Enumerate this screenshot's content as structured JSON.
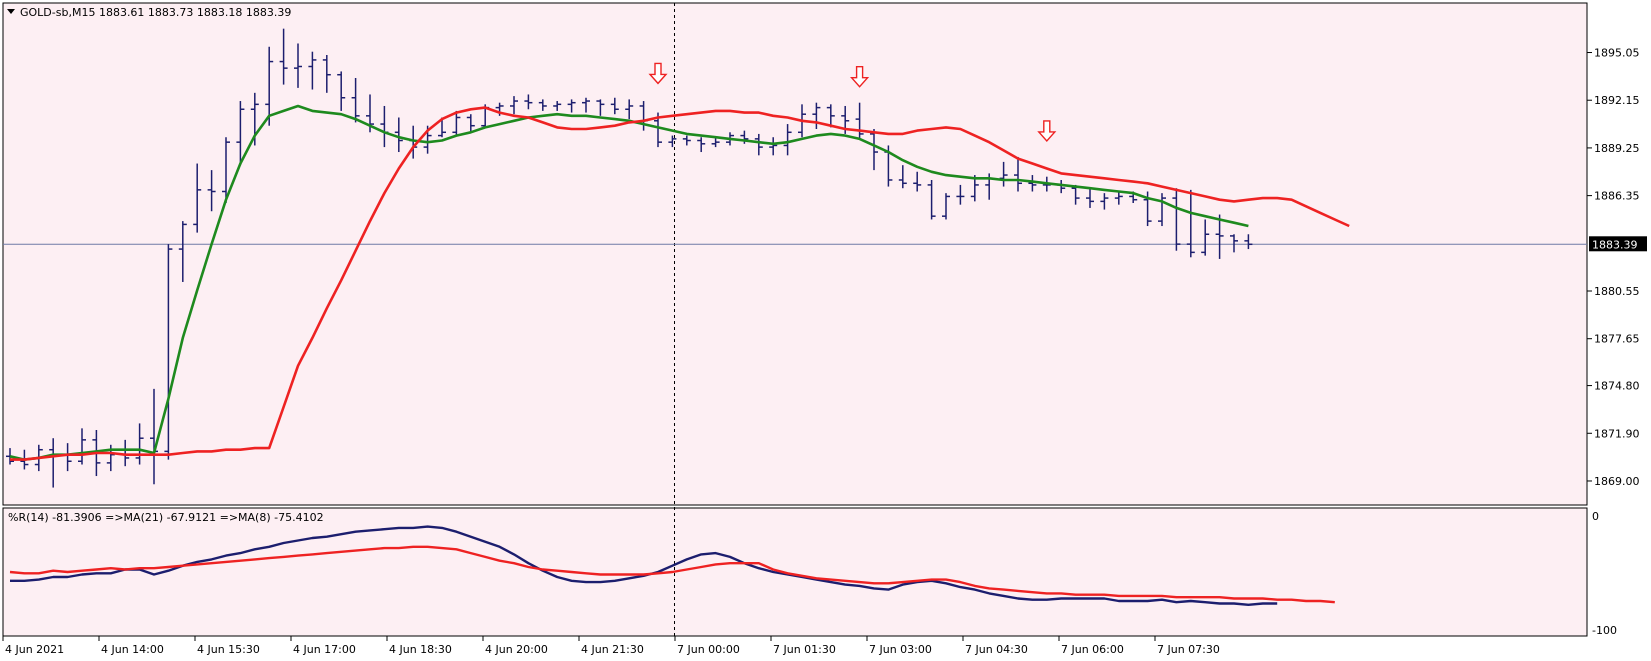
{
  "window": {
    "symbol_info": "GOLD-sb,M15  1883.61 1883.73 1883.18 1883.39",
    "background": "#fdeff3"
  },
  "indicator": {
    "label": "%R(14) -81.3906  =>MA(21) -67.9121  =>MA(8) -75.4102",
    "scale_top": "0",
    "scale_bottom": "-100"
  },
  "colors": {
    "bars": "#1c1e6e",
    "ma_fast": "#1e8a1e",
    "ma_slow": "#ee2222",
    "wpr_line": "#1c1e6e",
    "wpr_ma": "#ee2222",
    "price_line": "#6f7aa6",
    "arrow": "#ee2222"
  },
  "current_price": "1883.39",
  "chart_data": [
    {
      "type": "ohlc",
      "title": "GOLD-sb,M15",
      "price_ticks": [
        "1895.05",
        "1892.15",
        "1889.25",
        "1886.35",
        "1883.39",
        "1880.55",
        "1877.65",
        "1874.80",
        "1871.90",
        "1869.00"
      ],
      "y_range": [
        1867.6,
        1898.0
      ],
      "time_labels": [
        "4 Jun 2021",
        "4 Jun 14:00",
        "4 Jun 15:30",
        "4 Jun 17:00",
        "4 Jun 18:30",
        "4 Jun 20:00",
        "4 Jun 21:30",
        "7 Jun 00:00",
        "7 Jun 01:30",
        "7 Jun 03:00",
        "7 Jun 04:30",
        "7 Jun 06:00",
        "7 Jun 07:30"
      ],
      "bars": [
        [
          1870.5,
          1871.0,
          1870.0,
          1870.2
        ],
        [
          1870.2,
          1870.9,
          1869.7,
          1870.0
        ],
        [
          1870.0,
          1871.2,
          1869.6,
          1870.9
        ],
        [
          1870.9,
          1871.6,
          1868.6,
          1870.6
        ],
        [
          1870.6,
          1871.3,
          1869.6,
          1870.2
        ],
        [
          1870.2,
          1872.2,
          1870.0,
          1871.5
        ],
        [
          1871.5,
          1872.1,
          1869.3,
          1870.1
        ],
        [
          1870.1,
          1871.2,
          1869.6,
          1870.6
        ],
        [
          1870.6,
          1871.5,
          1869.9,
          1870.4
        ],
        [
          1870.4,
          1872.5,
          1870.0,
          1871.6
        ],
        [
          1871.6,
          1874.6,
          1868.8,
          1870.8
        ],
        [
          1870.8,
          1883.4,
          1870.3,
          1883.1
        ],
        [
          1883.1,
          1884.8,
          1881.1,
          1884.6
        ],
        [
          1884.6,
          1888.3,
          1884.1,
          1886.7
        ],
        [
          1886.7,
          1887.9,
          1885.4,
          1886.6
        ],
        [
          1886.6,
          1889.9,
          1885.9,
          1889.6
        ],
        [
          1889.6,
          1892.1,
          1888.2,
          1891.6
        ],
        [
          1891.6,
          1892.6,
          1889.4,
          1891.9
        ],
        [
          1891.9,
          1895.4,
          1890.6,
          1894.5
        ],
        [
          1894.5,
          1896.5,
          1893.1,
          1894.1
        ],
        [
          1894.1,
          1895.6,
          1892.9,
          1894.2
        ],
        [
          1894.2,
          1895.1,
          1892.8,
          1894.6
        ],
        [
          1894.6,
          1894.9,
          1892.6,
          1893.7
        ],
        [
          1893.7,
          1893.9,
          1891.5,
          1892.3
        ],
        [
          1892.3,
          1893.5,
          1890.8,
          1891.2
        ],
        [
          1891.2,
          1892.5,
          1890.2,
          1890.7
        ],
        [
          1890.7,
          1891.8,
          1889.3,
          1890.2
        ],
        [
          1890.2,
          1891.1,
          1889.0,
          1889.7
        ],
        [
          1889.7,
          1890.6,
          1888.6,
          1889.3
        ],
        [
          1889.3,
          1890.6,
          1888.9,
          1890.0
        ],
        [
          1890.0,
          1891.1,
          1889.9,
          1890.2
        ],
        [
          1890.2,
          1891.5,
          1890.0,
          1891.1
        ],
        [
          1891.1,
          1891.3,
          1890.2,
          1890.6
        ],
        [
          1890.6,
          1891.9,
          1890.5,
          1891.7
        ],
        [
          1891.7,
          1892.0,
          1891.2,
          1891.8
        ],
        [
          1891.8,
          1892.4,
          1891.3,
          1892.1
        ],
        [
          1892.1,
          1892.5,
          1891.6,
          1892.0
        ],
        [
          1892.0,
          1892.2,
          1891.5,
          1891.8
        ],
        [
          1891.8,
          1892.1,
          1891.5,
          1891.9
        ],
        [
          1891.9,
          1892.2,
          1891.4,
          1892.0
        ],
        [
          1892.0,
          1892.3,
          1891.4,
          1892.1
        ],
        [
          1892.1,
          1892.2,
          1891.2,
          1891.9
        ],
        [
          1891.9,
          1892.3,
          1891.3,
          1891.6
        ],
        [
          1891.6,
          1892.2,
          1891.0,
          1891.8
        ],
        [
          1891.8,
          1892.1,
          1890.3,
          1890.9
        ],
        [
          1890.9,
          1891.4,
          1889.3,
          1889.6
        ],
        [
          1889.6,
          1890.0,
          1889.3,
          1889.8
        ],
        [
          1889.8,
          1890.0,
          1889.4,
          1889.7
        ],
        [
          1889.7,
          1889.9,
          1889.0,
          1889.5
        ],
        [
          1889.5,
          1889.9,
          1889.3,
          1889.6
        ],
        [
          1889.6,
          1890.2,
          1889.4,
          1890.0
        ],
        [
          1890.0,
          1890.3,
          1889.5,
          1889.8
        ],
        [
          1889.8,
          1890.1,
          1888.8,
          1889.3
        ],
        [
          1889.3,
          1889.9,
          1888.8,
          1889.4
        ],
        [
          1889.4,
          1890.7,
          1888.8,
          1890.2
        ],
        [
          1890.2,
          1891.9,
          1889.9,
          1891.3
        ],
        [
          1891.3,
          1892.0,
          1890.4,
          1891.7
        ],
        [
          1891.7,
          1891.9,
          1890.5,
          1891.2
        ],
        [
          1891.2,
          1891.8,
          1890.1,
          1890.9
        ],
        [
          1891.0,
          1892.0,
          1889.8,
          1890.1
        ],
        [
          1890.1,
          1890.4,
          1887.9,
          1889.0
        ],
        [
          1889.0,
          1889.4,
          1886.9,
          1887.3
        ],
        [
          1887.3,
          1888.2,
          1886.8,
          1887.1
        ],
        [
          1887.1,
          1887.8,
          1886.6,
          1887.0
        ],
        [
          1887.0,
          1887.3,
          1884.9,
          1885.1
        ],
        [
          1885.1,
          1886.5,
          1884.9,
          1886.3
        ],
        [
          1886.3,
          1887.0,
          1885.8,
          1886.3
        ],
        [
          1886.3,
          1887.6,
          1886.0,
          1887.0
        ],
        [
          1887.0,
          1887.7,
          1886.1,
          1887.4
        ],
        [
          1887.4,
          1888.4,
          1886.9,
          1887.6
        ],
        [
          1887.6,
          1888.7,
          1886.6,
          1887.1
        ],
        [
          1887.1,
          1887.6,
          1886.6,
          1887.0
        ],
        [
          1887.0,
          1887.5,
          1886.6,
          1887.0
        ],
        [
          1887.0,
          1887.3,
          1886.5,
          1886.8
        ],
        [
          1886.8,
          1887.0,
          1885.8,
          1886.2
        ],
        [
          1886.2,
          1886.8,
          1885.6,
          1886.0
        ],
        [
          1886.0,
          1886.5,
          1885.5,
          1886.2
        ],
        [
          1886.2,
          1886.6,
          1885.8,
          1886.3
        ],
        [
          1886.3,
          1886.6,
          1885.9,
          1886.1
        ],
        [
          1886.1,
          1886.6,
          1884.5,
          1884.8
        ],
        [
          1884.8,
          1886.5,
          1884.5,
          1886.2
        ],
        [
          1886.2,
          1886.8,
          1883.0,
          1883.4
        ],
        [
          1883.4,
          1886.7,
          1882.6,
          1882.9
        ],
        [
          1882.9,
          1884.9,
          1882.7,
          1884.0
        ],
        [
          1884.0,
          1885.2,
          1882.5,
          1883.9
        ],
        [
          1883.9,
          1884.0,
          1882.9,
          1883.6
        ],
        [
          1883.6,
          1884.0,
          1883.1,
          1883.39
        ]
      ],
      "series": [
        {
          "name": "",
          "color": "ma_fast",
          "values": [
            1870.5,
            1870.3,
            1870.4,
            1870.6,
            1870.6,
            1870.7,
            1870.8,
            1870.9,
            1870.9,
            1870.9,
            1870.7,
            1874.0,
            1877.7,
            1880.6,
            1883.4,
            1886.1,
            1888.3,
            1890.0,
            1891.2,
            1891.5,
            1891.8,
            1891.5,
            1891.4,
            1891.3,
            1891.0,
            1890.6,
            1890.2,
            1889.9,
            1889.7,
            1889.6,
            1889.7,
            1890.0,
            1890.2,
            1890.5,
            1890.7,
            1890.9,
            1891.1,
            1891.2,
            1891.3,
            1891.2,
            1891.2,
            1891.1,
            1891.0,
            1890.9,
            1890.7,
            1890.5,
            1890.3,
            1890.1,
            1890.0,
            1889.9,
            1889.8,
            1889.7,
            1889.6,
            1889.5,
            1889.6,
            1889.8,
            1890.0,
            1890.1,
            1890.0,
            1889.8,
            1889.4,
            1889.0,
            1888.5,
            1888.1,
            1887.8,
            1887.6,
            1887.5,
            1887.4,
            1887.4,
            1887.3,
            1887.3,
            1887.2,
            1887.1,
            1887.0,
            1886.9,
            1886.8,
            1886.7,
            1886.6,
            1886.5,
            1886.2,
            1886.0,
            1885.6,
            1885.3,
            1885.1,
            1884.9,
            1884.7,
            1884.5
          ]
        },
        {
          "name": "",
          "color": "ma_slow",
          "values": [
            1870.3,
            1870.3,
            1870.4,
            1870.5,
            1870.6,
            1870.6,
            1870.7,
            1870.7,
            1870.6,
            1870.6,
            1870.6,
            1870.6,
            1870.7,
            1870.8,
            1870.8,
            1870.9,
            1870.9,
            1871.0,
            1871.0,
            1873.5,
            1876.0,
            1877.7,
            1879.5,
            1881.2,
            1883.0,
            1884.8,
            1886.5,
            1888.0,
            1889.3,
            1890.3,
            1891.0,
            1891.4,
            1891.6,
            1891.7,
            1891.4,
            1891.2,
            1891.1,
            1890.8,
            1890.5,
            1890.4,
            1890.4,
            1890.5,
            1890.6,
            1890.8,
            1890.9,
            1891.1,
            1891.2,
            1891.3,
            1891.4,
            1891.5,
            1891.5,
            1891.4,
            1891.4,
            1891.2,
            1891.1,
            1890.9,
            1890.8,
            1890.6,
            1890.4,
            1890.3,
            1890.2,
            1890.1,
            1890.1,
            1890.3,
            1890.4,
            1890.5,
            1890.4,
            1890.0,
            1889.6,
            1889.1,
            1888.6,
            1888.3,
            1888.0,
            1887.7,
            1887.6,
            1887.5,
            1887.4,
            1887.3,
            1887.2,
            1887.1,
            1886.9,
            1886.7,
            1886.5,
            1886.3,
            1886.1,
            1886.0,
            1886.1,
            1886.2,
            1886.2,
            1886.1,
            1885.7,
            1885.3,
            1884.9,
            1884.5
          ]
        }
      ],
      "arrows_at_bars": [
        45,
        59,
        72
      ]
    },
    {
      "type": "line",
      "title": "%R(14)",
      "y_range": [
        -100,
        0
      ],
      "series": [
        {
          "name": "%R(14)",
          "color": "wpr_line",
          "values": [
            -57,
            -57,
            -56,
            -54,
            -54,
            -52,
            -51,
            -51,
            -48,
            -48,
            -52,
            -49,
            -45,
            -42,
            -40,
            -37,
            -35,
            -32,
            -30,
            -27,
            -25,
            -23,
            -22,
            -20,
            -18,
            -17,
            -16,
            -15,
            -15,
            -14,
            -15,
            -18,
            -22,
            -26,
            -30,
            -36,
            -43,
            -49,
            -54,
            -57,
            -58,
            -58,
            -57,
            -55,
            -53,
            -50,
            -45,
            -40,
            -36,
            -35,
            -38,
            -43,
            -47,
            -50,
            -52,
            -54,
            -56,
            -58,
            -60,
            -61,
            -63,
            -64,
            -60,
            -58,
            -57,
            -59,
            -62,
            -64,
            -67,
            -69,
            -71,
            -72,
            -72,
            -71,
            -71,
            -71,
            -71,
            -73,
            -73,
            -73,
            -72,
            -74,
            -73,
            -74,
            -75,
            -75,
            -76,
            -75,
            -75
          ]
        },
        {
          "name": "MA(21)",
          "color": "wpr_ma",
          "values": [
            -50,
            -51,
            -51,
            -49,
            -50,
            -49,
            -48,
            -47,
            -48,
            -47,
            -47,
            -46,
            -45,
            -44,
            -43,
            -42,
            -41,
            -40,
            -39,
            -38,
            -37,
            -36,
            -35,
            -34,
            -33,
            -32,
            -31,
            -31,
            -30,
            -30,
            -31,
            -32,
            -35,
            -38,
            -41,
            -43,
            -46,
            -48,
            -49,
            -50,
            -51,
            -52,
            -52,
            -52,
            -52,
            -51,
            -50,
            -48,
            -46,
            -44,
            -43,
            -43,
            -43,
            -48,
            -51,
            -53,
            -55,
            -56,
            -57,
            -58,
            -59,
            -59,
            -58,
            -57,
            -56,
            -56,
            -58,
            -61,
            -63,
            -64,
            -65,
            -66,
            -67,
            -67,
            -68,
            -68,
            -68,
            -69,
            -69,
            -69,
            -69,
            -70,
            -70,
            -70,
            -70,
            -71,
            -71,
            -71,
            -72,
            -72,
            -73,
            -73,
            -74
          ]
        }
      ]
    }
  ]
}
